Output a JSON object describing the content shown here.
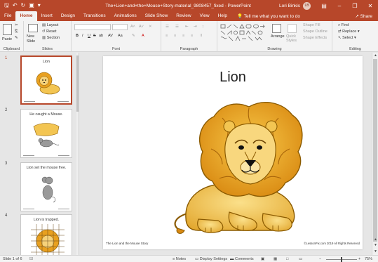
{
  "titlebar": {
    "qat": [
      "save-icon",
      "undo-icon",
      "redo-icon",
      "present-icon",
      "customize-icon"
    ],
    "title": "The+Lion+and+the+Mouse+Story-material_9808457_fixed - PowerPoint",
    "user": "Lori Binkis",
    "avatar_initials": "LB"
  },
  "tabs": [
    "File",
    "Home",
    "Insert",
    "Design",
    "Transitions",
    "Animations",
    "Slide Show",
    "Review",
    "View",
    "Help"
  ],
  "tellme": "Tell me what you want to do",
  "share": "Share",
  "ribbon": {
    "clipboard": {
      "paste": "Paste",
      "label": "Clipboard"
    },
    "slides": {
      "new_slide": "New Slide",
      "layout": "Layout",
      "reset": "Reset",
      "section": "Section",
      "label": "Slides"
    },
    "font": {
      "label": "Font",
      "buttons": [
        "B",
        "I",
        "U",
        "S",
        "ab",
        "AV",
        "Aa"
      ]
    },
    "paragraph": {
      "label": "Paragraph"
    },
    "drawing": {
      "label": "Drawing",
      "arrange": "Arrange",
      "quick_styles": "Quick Styles",
      "shape_fill": "Shape Fill",
      "shape_outline": "Shape Outline",
      "shape_effects": "Shape Effects"
    },
    "editing": {
      "label": "Editing",
      "find": "Find",
      "replace": "Replace",
      "select": "Select"
    }
  },
  "thumbnails": [
    {
      "num": "1",
      "title": "Lion"
    },
    {
      "num": "2",
      "title": "He caught a Mouse."
    },
    {
      "num": "3",
      "title": "Lion set the mouse free."
    },
    {
      "num": "4",
      "title": "Lion is trapped."
    }
  ],
  "slide": {
    "title": "Lion",
    "footer_left": "The Lion and the Mouse Story",
    "footer_right": "©LessonPix.com 2019  All Rights Reserved"
  },
  "status": {
    "slide_count": "Slide 1 of 6",
    "notes": "Notes",
    "display_settings": "Display Settings",
    "comments": "Comments",
    "zoom": "75%"
  },
  "colors": {
    "accent": "#b7472a",
    "lion_mane": "#e8a020",
    "lion_body": "#f3c552"
  }
}
